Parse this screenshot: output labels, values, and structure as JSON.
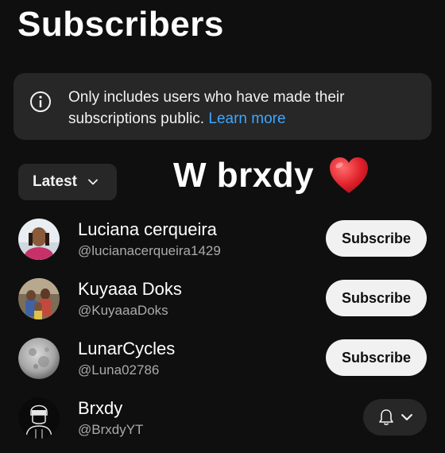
{
  "page": {
    "title": "Subscribers"
  },
  "info_banner": {
    "icon": "info-icon",
    "text": "Only includes users who have made their subscriptions public.",
    "link_label": "Learn more",
    "link_color": "#3ea6ff"
  },
  "sort": {
    "selected": "Latest",
    "icon": "chevron-down-icon"
  },
  "overlay_caption": {
    "text": "W brxdy",
    "emoji": "heart-icon",
    "emoji_color": "#e0202a"
  },
  "subscribers": [
    {
      "name": "Luciana cerqueira",
      "handle": "@lucianacerqueira1429",
      "action": "Subscribe"
    },
    {
      "name": "Kuyaaa Doks",
      "handle": "@KuyaaaDoks",
      "action": "Subscribe"
    },
    {
      "name": "LunarCycles",
      "handle": "@Luna02786",
      "action": "Subscribe"
    },
    {
      "name": "Brxdy",
      "handle": "@BrxdyYT",
      "action_icon": "bell-icon"
    }
  ],
  "colors": {
    "background": "#0f0f0f",
    "card": "#272727",
    "button_light": "#f1f1f1",
    "secondary_text": "#aaaaaa"
  }
}
